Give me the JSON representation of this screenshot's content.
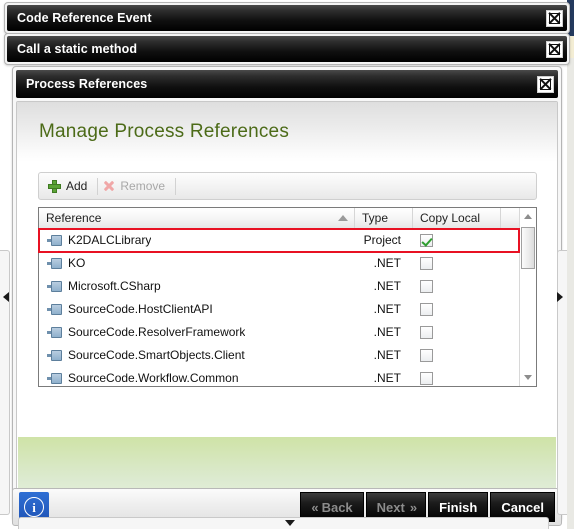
{
  "windows": {
    "code_reference_event": {
      "title": "Code Reference Event",
      "close_label": "Close"
    },
    "call_static_method": {
      "title": "Call a static method",
      "close_label": "Close"
    },
    "process_references": {
      "title": "Process References",
      "close_label": "Close"
    }
  },
  "dialog": {
    "page_title": "Manage Process References",
    "toolbar": {
      "add_label": "Add",
      "remove_label": "Remove",
      "remove_disabled": true
    },
    "grid": {
      "columns": [
        {
          "key": "reference",
          "label": "Reference",
          "sorted": "ascending"
        },
        {
          "key": "type",
          "label": "Type"
        },
        {
          "key": "copy_local",
          "label": "Copy Local"
        }
      ],
      "rows": [
        {
          "reference": "K2DALCLibrary",
          "type": "Project",
          "copy_local": true,
          "selected": true
        },
        {
          "reference": "KO",
          "type": ".NET",
          "copy_local": false,
          "selected": false
        },
        {
          "reference": "Microsoft.CSharp",
          "type": ".NET",
          "copy_local": false,
          "selected": false
        },
        {
          "reference": "SourceCode.HostClientAPI",
          "type": ".NET",
          "copy_local": false,
          "selected": false
        },
        {
          "reference": "SourceCode.ResolverFramework",
          "type": ".NET",
          "copy_local": false,
          "selected": false
        },
        {
          "reference": "SourceCode.SmartObjects.Client",
          "type": ".NET",
          "copy_local": false,
          "selected": false
        },
        {
          "reference": "SourceCode.Workflow.Common",
          "type": ".NET",
          "copy_local": false,
          "selected": false
        }
      ]
    }
  },
  "actionbar": {
    "info_label": "i",
    "back_label": "Back",
    "next_label": "Next",
    "finish_label": "Finish",
    "cancel_label": "Cancel",
    "back_disabled": true,
    "next_disabled": true
  },
  "colors": {
    "title_accent": "#4c6b18",
    "selection_outline": "#e81123",
    "checkbox_check": "#2f9e2f",
    "info_button": "#1f53b5",
    "green_panel": "#cfe3a7"
  }
}
